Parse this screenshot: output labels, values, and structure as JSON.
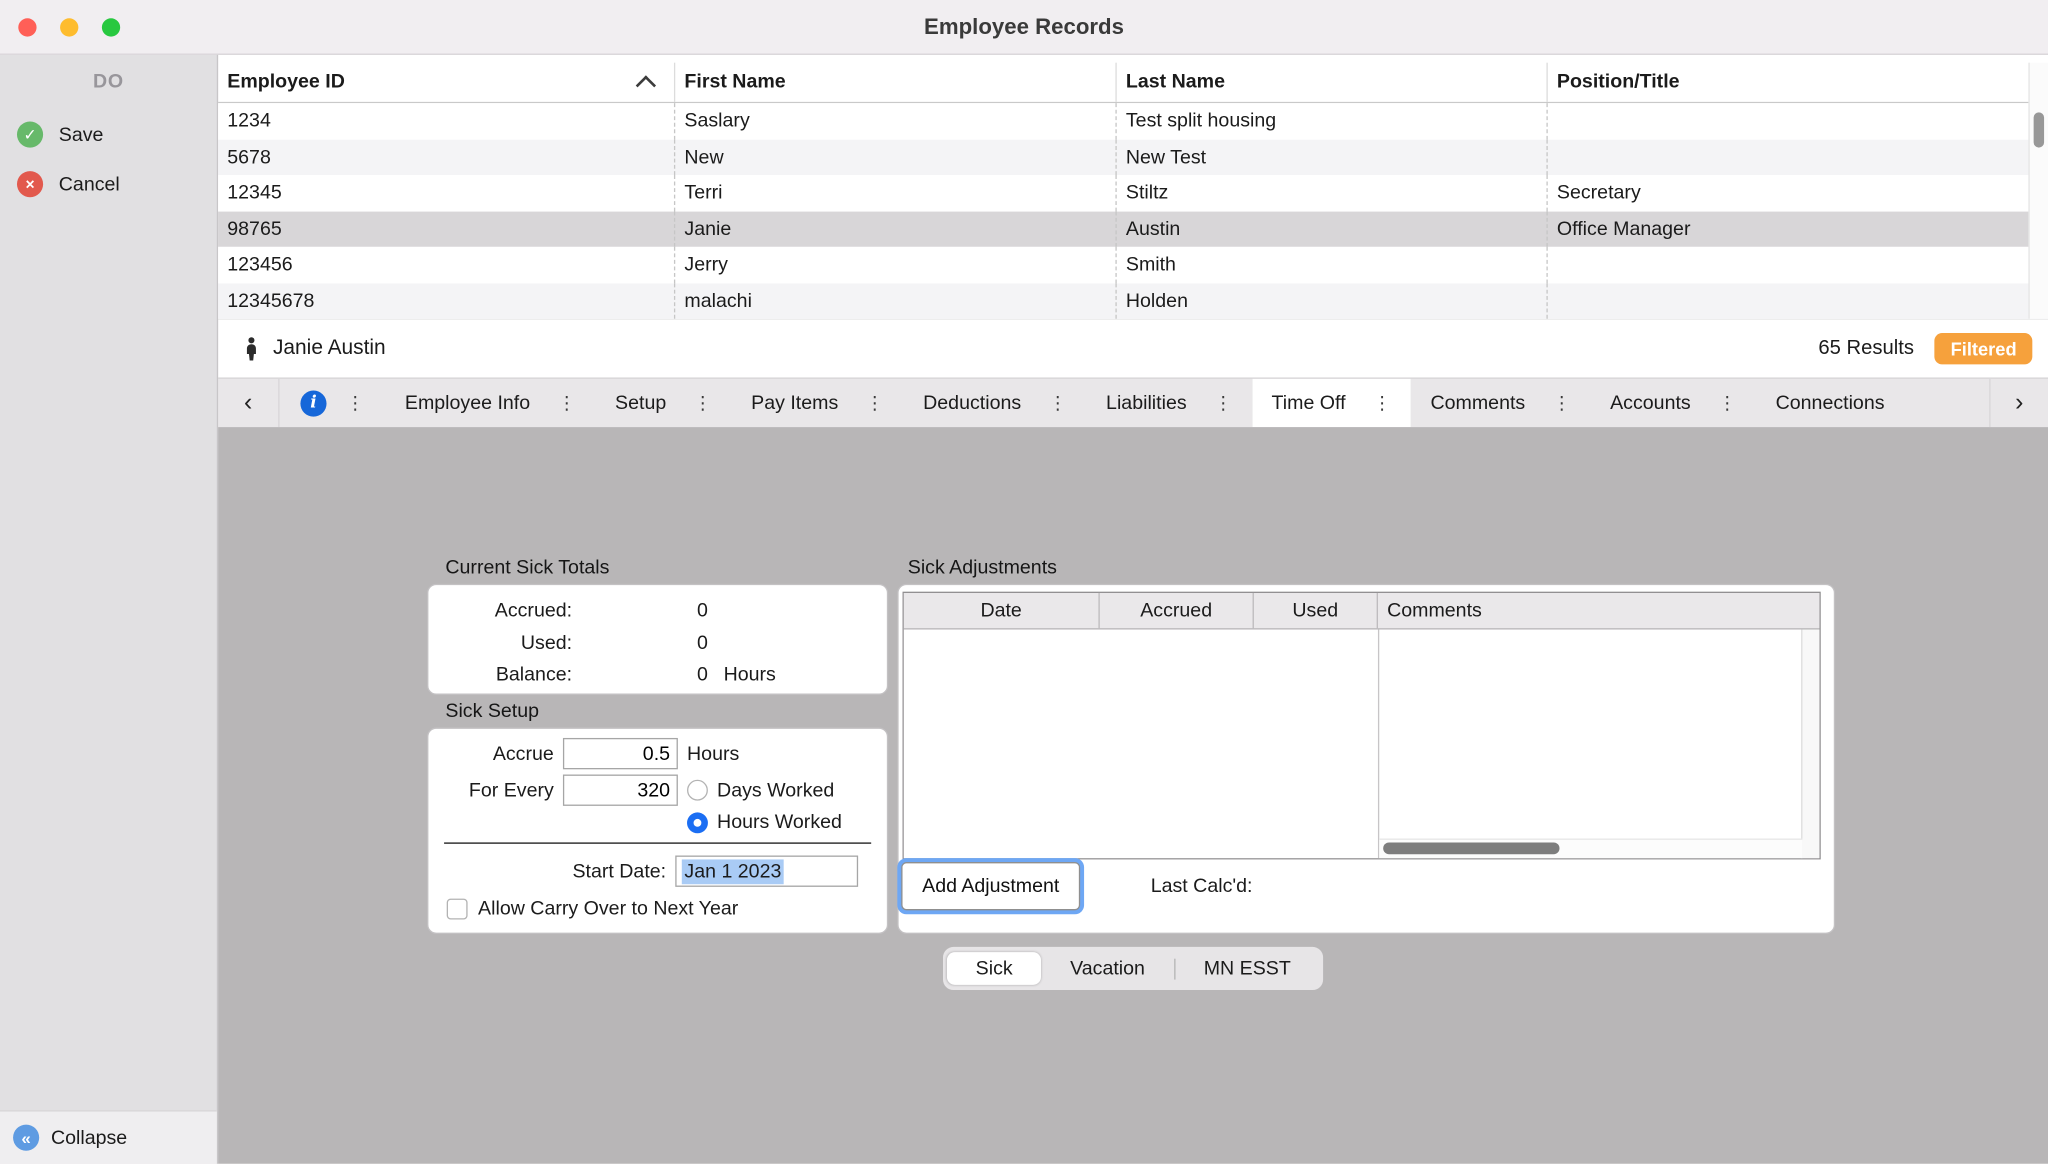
{
  "window": {
    "title": "Employee Records"
  },
  "sidebar": {
    "header": "DO",
    "save": "Save",
    "cancel": "Cancel",
    "collapse": "Collapse"
  },
  "employee_table": {
    "columns": [
      "Employee ID",
      "First Name",
      "Last Name",
      "Position/Title"
    ],
    "rows": [
      [
        "1234",
        "Saslary",
        "Test split housing",
        ""
      ],
      [
        "5678",
        "New",
        "New Test",
        ""
      ],
      [
        "12345",
        "Terri",
        "Stiltz",
        "Secretary"
      ],
      [
        "98765",
        "Janie",
        "Austin",
        "Office Manager"
      ],
      [
        "123456",
        "Jerry",
        "Smith",
        ""
      ],
      [
        "12345678",
        "malachi",
        "Holden",
        ""
      ]
    ],
    "selected_row_index": 3,
    "sort_column": "Employee ID",
    "sort_direction": "ascending"
  },
  "record_bar": {
    "name": "Janie Austin",
    "results": "65 Results",
    "filtered": "Filtered"
  },
  "nav_tabs": {
    "items": [
      "Employee Info",
      "Setup",
      "Pay Items",
      "Deductions",
      "Liabilities",
      "Time Off",
      "Comments",
      "Accounts",
      "Connections"
    ],
    "selected": "Time Off"
  },
  "time_off": {
    "totals": {
      "title": "Current Sick Totals",
      "rows": [
        {
          "label": "Accrued:",
          "value": "0",
          "suffix": ""
        },
        {
          "label": "Used:",
          "value": "0",
          "suffix": ""
        },
        {
          "label": "Balance:",
          "value": "0",
          "suffix": "Hours"
        }
      ]
    },
    "setup": {
      "title": "Sick Setup",
      "accrue_label": "Accrue",
      "accrue_value": "0.5",
      "accrue_suffix": "Hours",
      "for_every_label": "For Every",
      "for_every_value": "320",
      "radio_days": "Days Worked",
      "radio_hours": "Hours Worked",
      "radio_selected": "Hours Worked",
      "start_date_label": "Start Date:",
      "start_date_value": "Jan 1 2023",
      "carry_over_label": "Allow Carry Over to Next Year",
      "carry_over_checked": false
    },
    "adjustments": {
      "title": "Sick Adjustments",
      "columns": [
        "Date",
        "Accrued",
        "Used",
        "Comments"
      ],
      "add_button": "Add Adjustment",
      "last_calcd": "Last Calc'd:"
    },
    "bottom_tabs": {
      "items": [
        "Sick",
        "Vacation",
        "MN ESST"
      ],
      "selected": "Sick"
    }
  },
  "icons": {
    "back": "‹",
    "forward": "›",
    "menu_dots": "⋮",
    "info": "i",
    "collapse": "«",
    "save_check": "✓",
    "cancel_x": "×"
  },
  "colors": {
    "filtered_badge": "#F6A13C",
    "accent_blue": "#1B6EF3",
    "selection_highlight": "#A9CBF5",
    "selected_row": "#D8D6D8",
    "detail_background": "#B8B6B7"
  }
}
